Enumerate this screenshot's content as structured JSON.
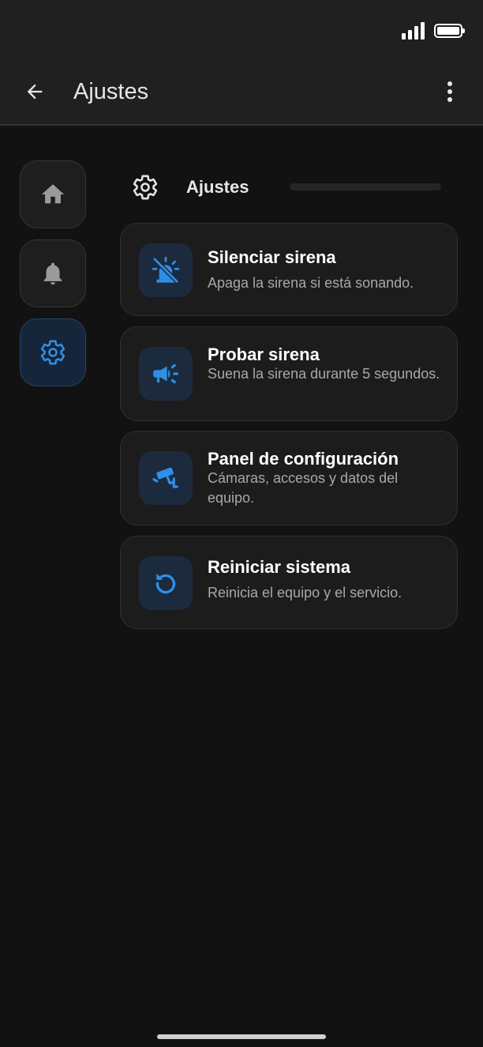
{
  "app_bar": {
    "title": "Ajustes",
    "back_icon": "arrow-left-icon",
    "menu_icon": "more-vertical-icon"
  },
  "status_bar": {
    "signal_icon": "signal-icon",
    "battery_icon": "battery-full-icon"
  },
  "nav_rail": [
    {
      "id": "home",
      "icon": "home-icon",
      "active": false
    },
    {
      "id": "notifications",
      "icon": "bell-icon",
      "active": false
    },
    {
      "id": "settings",
      "icon": "gear-icon",
      "active": true
    }
  ],
  "section": {
    "title": "Ajustes",
    "icon": "gear-icon"
  },
  "cards": [
    {
      "title": "Silenciar sirena",
      "description": "Apaga la sirena si está sonando.",
      "icon": "siren-off-icon"
    },
    {
      "title": "Probar sirena",
      "description": "Suena la sirena durante 5 segundos.",
      "icon": "megaphone-icon"
    },
    {
      "title": "Panel de configuración",
      "description": "Cámaras, accesos y datos del equipo.",
      "icon": "security-camera-icon"
    },
    {
      "title": "Reiniciar sistema",
      "description": "Reinicia el equipo y el servicio.",
      "icon": "restart-icon"
    }
  ],
  "colors": {
    "accent": "#2f8fe6",
    "background": "#121212",
    "surface": "#1c1c1c",
    "app_bar": "#202020"
  }
}
